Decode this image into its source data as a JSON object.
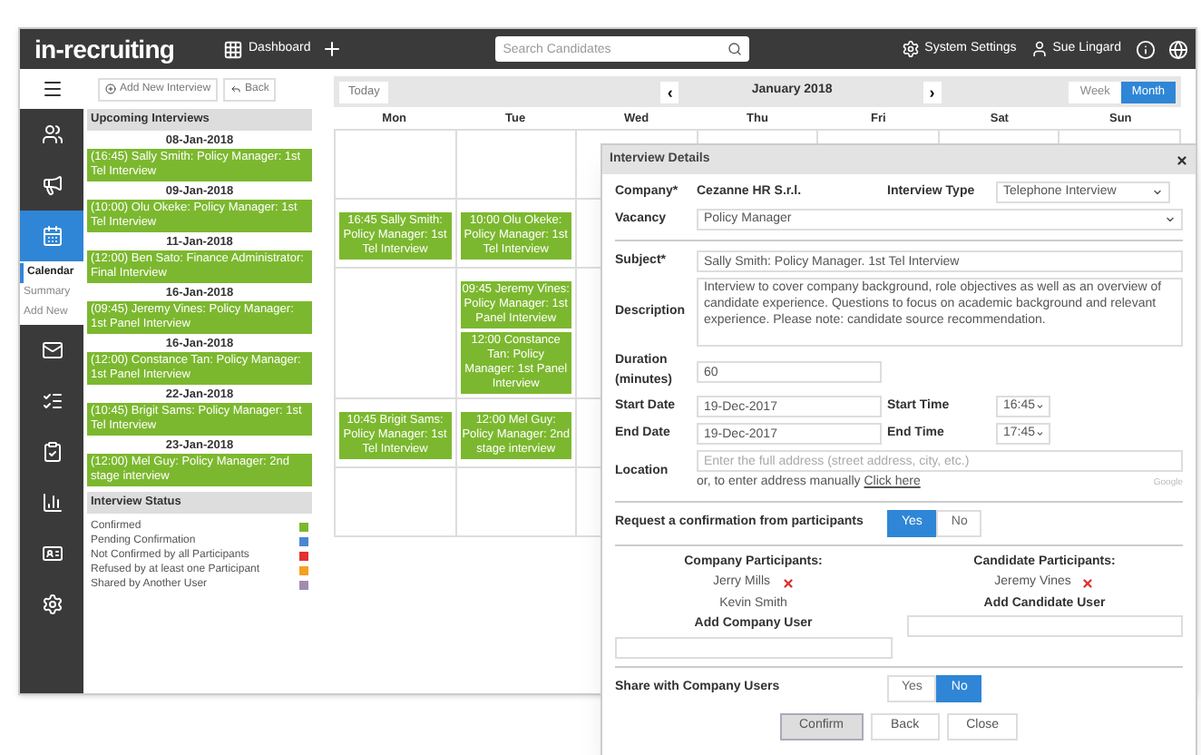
{
  "header": {
    "logo": "in-recruiting",
    "dashboard": "Dashboard",
    "search": {
      "placeholder": "Search Candidates"
    },
    "settings": "System Settings",
    "user": "Sue Lingard"
  },
  "sidebar": {
    "items": [
      {
        "kind": "users",
        "selected": false
      },
      {
        "kind": "megaphone",
        "selected": false
      },
      {
        "kind": "calendar",
        "selected": true,
        "children": [
          {
            "label": "Calendar",
            "selected": true
          },
          {
            "label": "Summary",
            "selected": false
          },
          {
            "label": "Add New",
            "selected": false
          }
        ]
      },
      {
        "kind": "mail",
        "selected": false
      },
      {
        "kind": "list",
        "selected": false
      },
      {
        "kind": "clipboard",
        "selected": false
      },
      {
        "kind": "chart",
        "selected": false
      },
      {
        "kind": "idcard",
        "selected": false
      },
      {
        "kind": "settings",
        "selected": false
      }
    ]
  },
  "toolbar": {
    "add": "Add New Interview",
    "back": "Back"
  },
  "upcoming": {
    "title": "Upcoming Interviews",
    "groups": [
      {
        "date": "08-Jan-2018",
        "items": [
          "(16:45) Sally Smith: Policy Manager: 1st Tel Interview"
        ]
      },
      {
        "date": "09-Jan-2018",
        "items": [
          "(10:00) Olu Okeke: Policy Manager: 1st Tel Interview"
        ]
      },
      {
        "date": "11-Jan-2018",
        "items": [
          "(12:00) Ben Sato: Finance Administrator: Final Interview"
        ]
      },
      {
        "date": "16-Jan-2018",
        "items": [
          "(09:45) Jeremy Vines: Policy Manager: 1st Panel Interview"
        ]
      },
      {
        "date": "16-Jan-2018",
        "items": [
          "(12:00) Constance Tan: Policy Manager: 1st Panel Interview"
        ]
      },
      {
        "date": "22-Jan-2018",
        "items": [
          "(10:45) Brigit Sams: Policy Manager: 1st Tel Interview"
        ]
      },
      {
        "date": "23-Jan-2018",
        "items": [
          "(12:00) Mel Guy: Policy Manager: 2nd stage interview"
        ]
      }
    ]
  },
  "status": {
    "title": "Interview Status",
    "items": [
      {
        "label": "Confirmed",
        "color": "#7cb82f"
      },
      {
        "label": "Pending Confirmation",
        "color": "#4a86d4"
      },
      {
        "label": "Not Confirmed by all Participants",
        "color": "#e53030"
      },
      {
        "label": "Refused by at least one Participant",
        "color": "#f5a020"
      },
      {
        "label": "Shared by Another User",
        "color": "#a08cb0"
      }
    ]
  },
  "calendar": {
    "today": "Today",
    "prev": "‹",
    "month": "January 2018",
    "next": "›",
    "views": [
      {
        "label": "Week",
        "selected": false
      },
      {
        "label": "Month",
        "selected": true
      }
    ],
    "days": [
      "Mon",
      "Tue",
      "Wed",
      "Thu",
      "Fri",
      "Sat",
      "Sun"
    ],
    "weeks": [
      {
        "cells": [
          {},
          {}
        ]
      },
      {
        "cells": [
          {
            "events": [
              "16:45 Sally Smith: Policy Manager: 1st Tel Interview"
            ]
          },
          {
            "events": [
              "10:00 Olu Okeke: Policy Manager: 1st Tel Interview"
            ]
          }
        ]
      },
      {
        "cells": [
          {},
          {
            "events": [
              "09:45 Jeremy Vines: Policy Manager: 1st Panel Interview",
              "12:00 Constance Tan: Policy Manager: 1st Panel Interview"
            ]
          }
        ]
      },
      {
        "cells": [
          {
            "events": [
              "10:45 Brigit Sams: Policy Manager: 1st Tel Interview"
            ]
          },
          {
            "events": [
              "12:00 Mel Guy: Policy Manager: 2nd stage interview"
            ]
          }
        ]
      },
      {
        "cells": [
          {},
          {}
        ]
      }
    ]
  },
  "modal": {
    "title": "Interview Details",
    "company": {
      "label": "Company*",
      "value": "Cezanne HR S.r.l."
    },
    "interview_type": {
      "label": "Interview Type",
      "value": "Telephone Interview"
    },
    "vacancy": {
      "label": "Vacancy",
      "value": "Policy Manager"
    },
    "subject": {
      "label": "Subject*",
      "value": "Sally Smith: Policy Manager. 1st Tel Interview"
    },
    "description": {
      "label": "Description",
      "value": "Interview to cover company background, role objectives as well as an overview of candidate experience.  Questions to focus on academic background and relevant experience. Please note:  candidate source recommendation."
    },
    "duration": {
      "label": "Duration (minutes)",
      "value": "60"
    },
    "start_date": {
      "label": "Start Date",
      "value": "19-Dec-2017"
    },
    "start_time": {
      "label": "Start Time",
      "value": "16:45"
    },
    "end_date": {
      "label": "End Date",
      "value": "19-Dec-2017"
    },
    "end_time": {
      "label": "End Time",
      "value": "17:45"
    },
    "location": {
      "label": "Location",
      "placeholder": "Enter the full address (street address, city, etc.)",
      "manual": "or, to enter address manually",
      "link": "Click here",
      "credit": "Google"
    },
    "confirmation": {
      "label": "Request a confirmation from participants",
      "options": [
        {
          "label": "Yes",
          "selected": true
        },
        {
          "label": "No",
          "selected": false
        }
      ]
    },
    "company_participants": {
      "title": "Company Participants:",
      "people": [
        {
          "name": "Jerry Mills",
          "removable": true
        },
        {
          "name": "Kevin Smith",
          "removable": false
        }
      ],
      "add": "Add Company User"
    },
    "candidate_participants": {
      "title": "Candidate Participants:",
      "people": [
        {
          "name": "Jeremy Vines",
          "removable": true
        }
      ],
      "add": "Add Candidate User"
    },
    "share": {
      "label": "Share with Company Users",
      "options": [
        {
          "label": "Yes",
          "selected": false
        },
        {
          "label": "No",
          "selected": true
        }
      ]
    },
    "buttons": [
      {
        "label": "Confirm",
        "focused": true
      },
      {
        "label": "Back",
        "focused": false
      },
      {
        "label": "Close",
        "focused": false
      }
    ]
  }
}
